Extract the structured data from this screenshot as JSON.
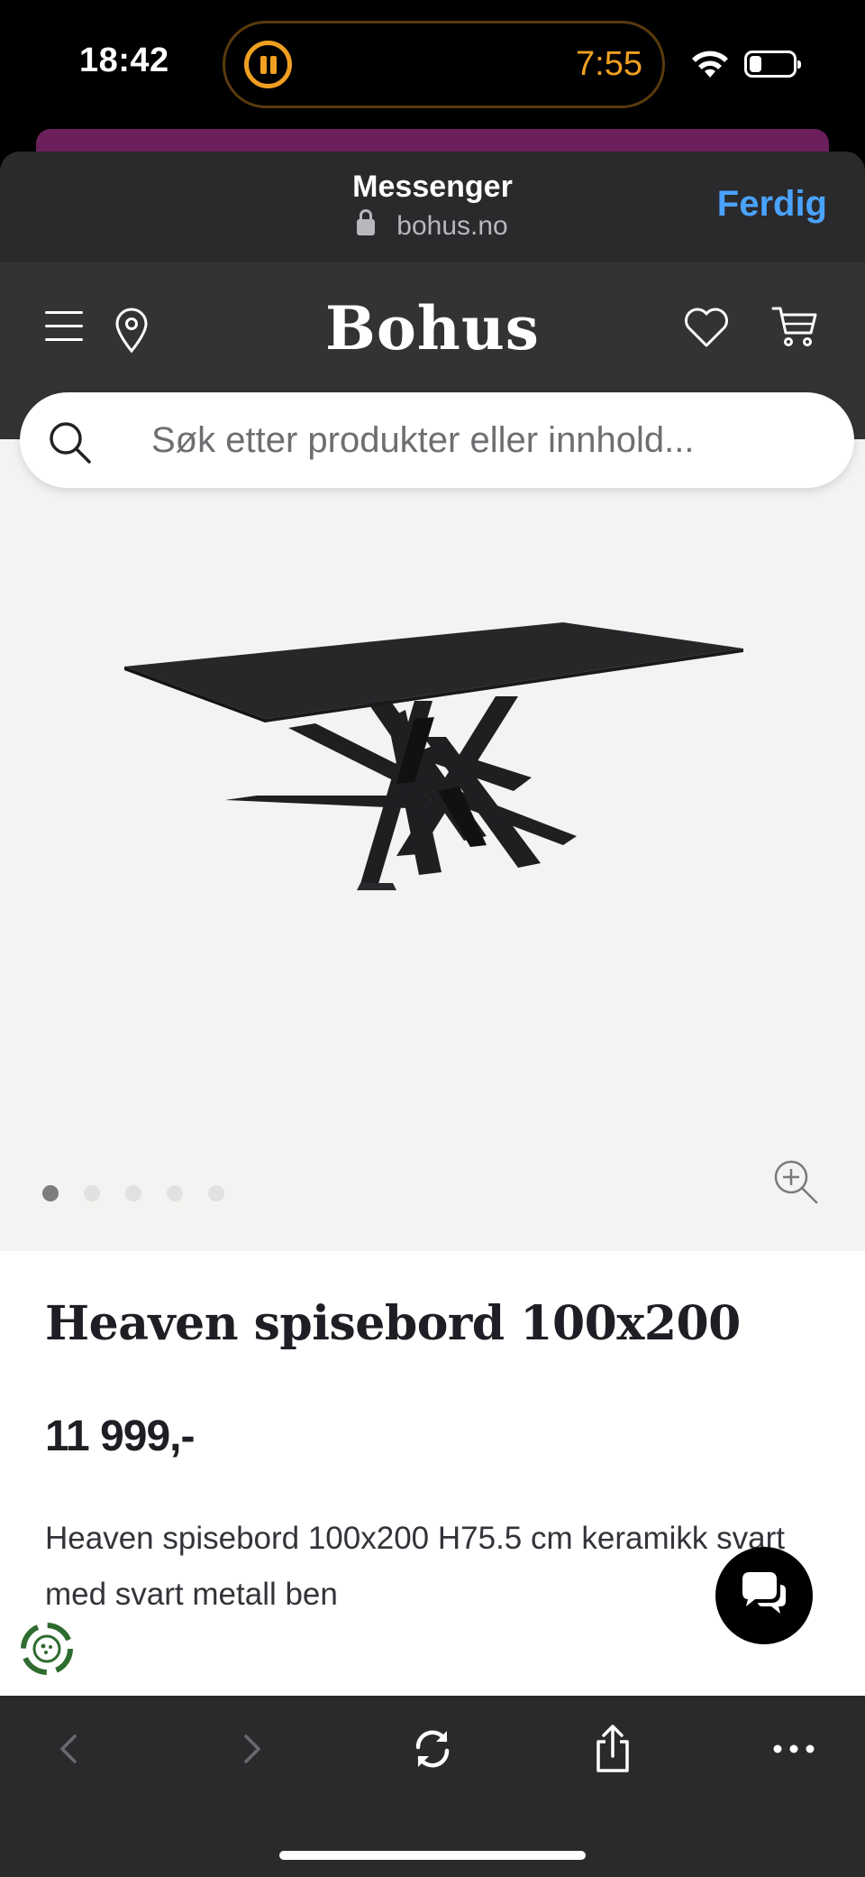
{
  "status_bar": {
    "time": "18:42",
    "timer": "7:55",
    "accent_color": "#f0a020"
  },
  "sheet": {
    "title": "Messenger",
    "url": "bohus.no",
    "done_label": "Ferdig",
    "done_color": "#4aa3ff"
  },
  "site": {
    "logo": "Bohus"
  },
  "search": {
    "placeholder": "Søk etter produkter eller innhold..."
  },
  "gallery": {
    "image_count": 5,
    "active_index": 0
  },
  "product": {
    "title": "Heaven spisebord 100x200",
    "price": "11 999,-",
    "description": "Heaven spisebord 100x200 H75.5 cm keramikk svart med svart metall ben"
  },
  "icons": {
    "header": [
      "menu-icon",
      "location-icon",
      "heart-icon",
      "cart-icon"
    ],
    "toolbar": [
      "back-icon",
      "forward-icon",
      "reload-icon",
      "share-icon",
      "more-icon"
    ]
  }
}
